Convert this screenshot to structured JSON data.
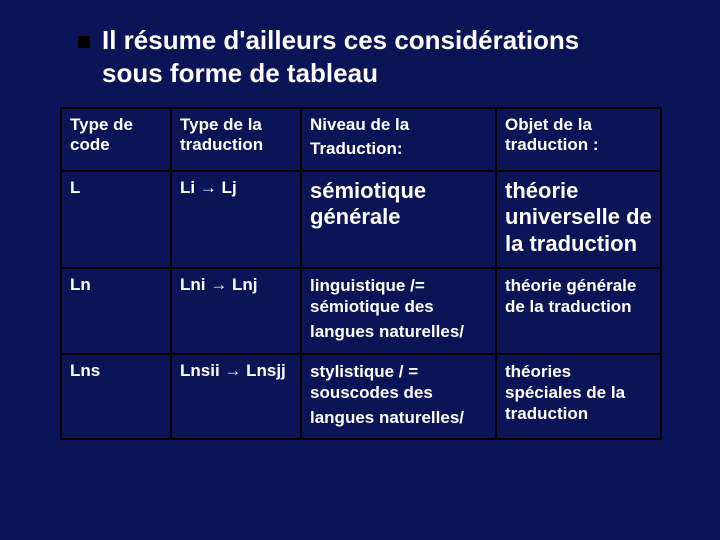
{
  "title": "Il résume d'ailleurs ces considérations sous forme de tableau",
  "headers": {
    "c0": "Type de code",
    "c1": "Type de la traduction",
    "c2": "Niveau de la",
    "c2b": "Traduction:",
    "c3": "Objet de la traduction :"
  },
  "rows": [
    {
      "code": "L",
      "map": "Li → Lj",
      "niveau": "sémiotique générale",
      "objet": "théorie universelle de la traduction"
    },
    {
      "code": "Ln",
      "map": "Lni → Lnj",
      "niveau1": "linguistique /= sémiotique des",
      "niveau2": "langues naturelles/",
      "objet": "théorie générale de la traduction"
    },
    {
      "code": "Lns",
      "map": "Lnsii → Lnsjj",
      "niveau1": "stylistique / = souscodes des",
      "niveau2": "langues naturelles/",
      "objet": "théories spéciales de la traduction"
    }
  ]
}
